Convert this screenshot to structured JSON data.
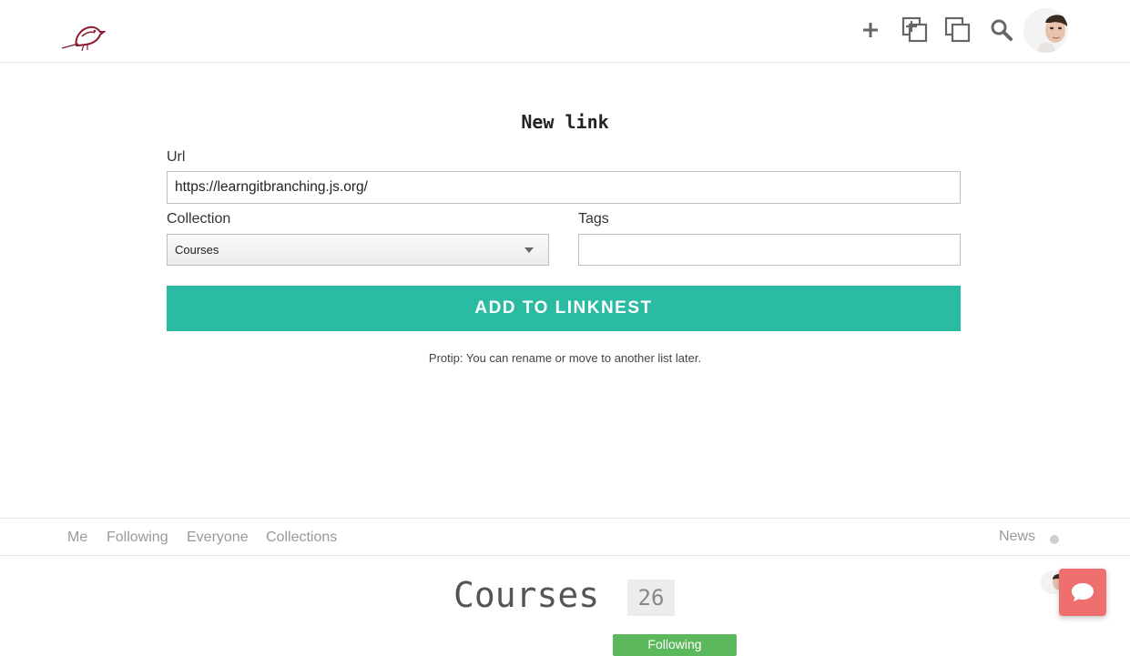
{
  "header": {
    "logo_icon": "bird-logo-icon",
    "add_icon": "plus-icon",
    "new_collection_icon": "add-collection-icon",
    "collections_icon": "collections-icon",
    "search_icon": "search-icon",
    "avatar_icon": "user-avatar"
  },
  "form": {
    "title": "New link",
    "url_label": "Url",
    "url_value": "https://learngitbranching.js.org/",
    "collection_label": "Collection",
    "collection_selected": "Courses",
    "tags_label": "Tags",
    "tags_value": "",
    "submit_label": "ADD TO LINKNEST",
    "protip": "Protip: You can rename or move to another list later."
  },
  "nav": {
    "items": [
      {
        "label": "Me"
      },
      {
        "label": "Following"
      },
      {
        "label": "Everyone"
      },
      {
        "label": "Collections"
      }
    ],
    "news_label": "News"
  },
  "collection": {
    "title": "Courses",
    "count": "26",
    "follow_label": "Following"
  },
  "colors": {
    "accent": "#2bbba3",
    "chat": "#ef6f6f",
    "logo": "#8b1a2b"
  }
}
